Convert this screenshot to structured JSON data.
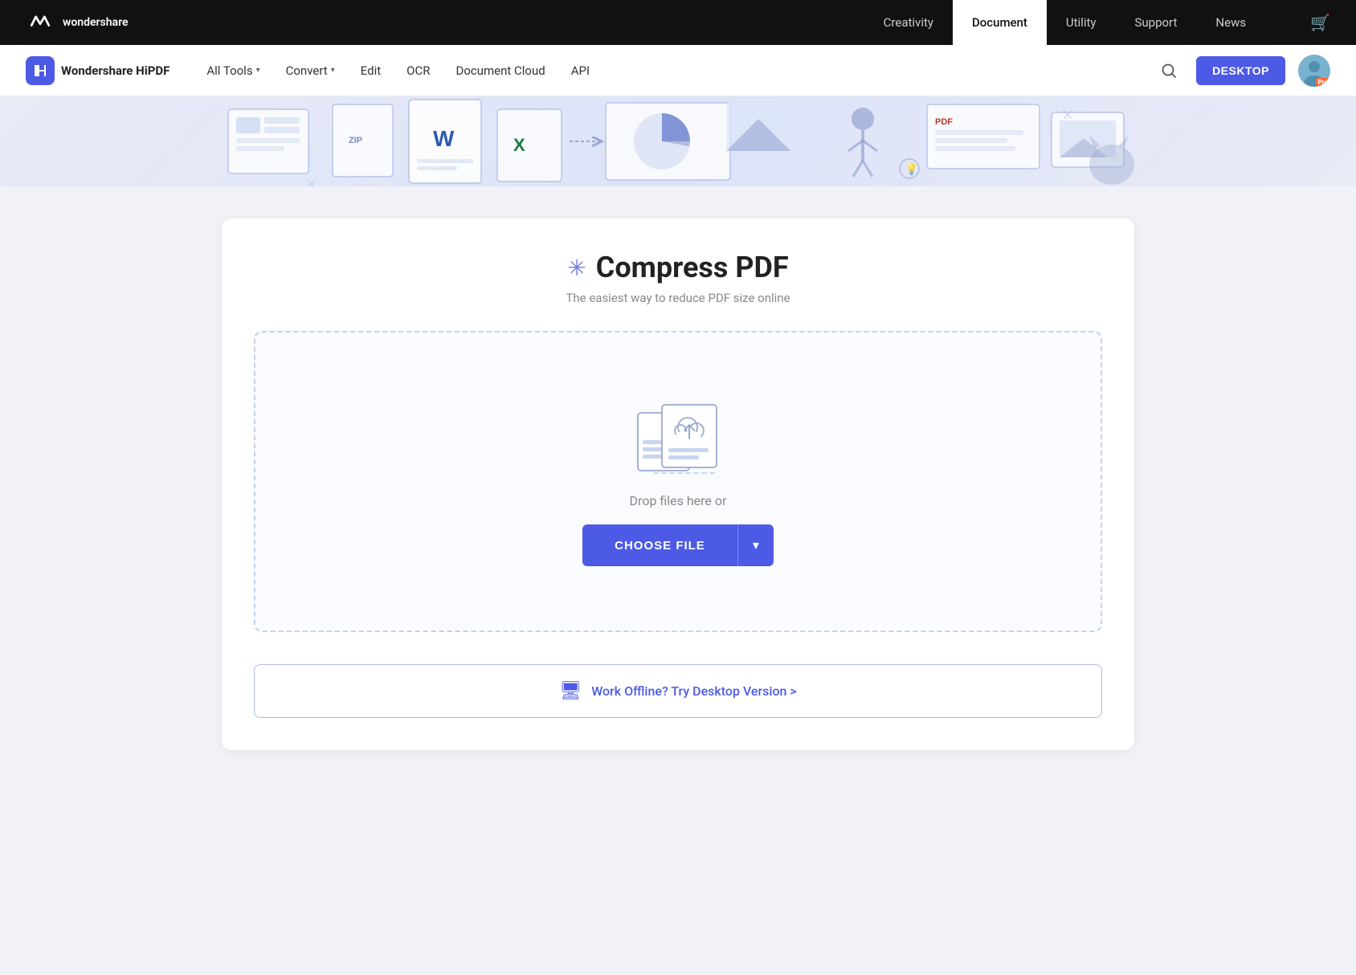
{
  "top_nav": {
    "logo_text": "wondershare",
    "links": [
      {
        "label": "Creativity",
        "active": false
      },
      {
        "label": "Document",
        "active": true
      },
      {
        "label": "Utility",
        "active": false
      },
      {
        "label": "Support",
        "active": false
      },
      {
        "label": "News",
        "active": false
      }
    ]
  },
  "second_nav": {
    "brand": "Wondershare HiPDF",
    "links": [
      {
        "label": "All Tools",
        "has_dropdown": true
      },
      {
        "label": "Convert",
        "has_dropdown": true
      },
      {
        "label": "Edit",
        "has_dropdown": false
      },
      {
        "label": "OCR",
        "has_dropdown": false
      },
      {
        "label": "Document Cloud",
        "has_dropdown": false
      },
      {
        "label": "API",
        "has_dropdown": false
      }
    ],
    "desktop_btn": "DESKTOP",
    "pro_badge": "Pro"
  },
  "hero": {
    "alt": "PDF tools illustration"
  },
  "compress": {
    "title": "Compress PDF",
    "subtitle": "The easiest way to reduce PDF size online",
    "drop_text": "Drop files here or",
    "choose_file_label": "CHOOSE FILE",
    "offline_text": "Work Offline? Try Desktop Version >"
  }
}
